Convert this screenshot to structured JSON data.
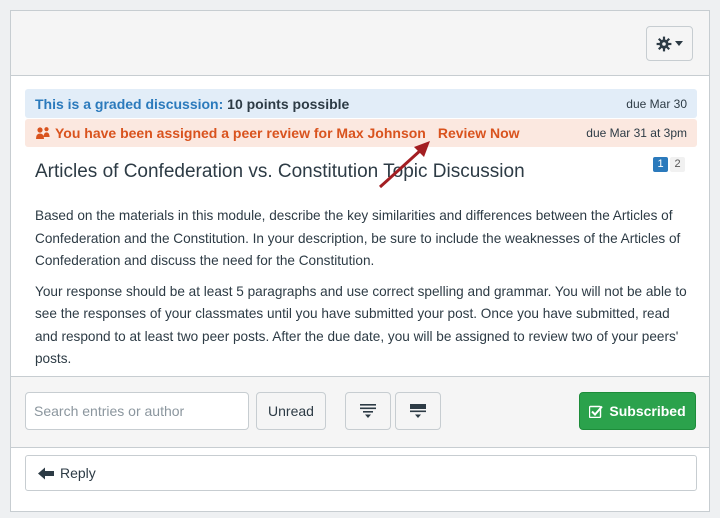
{
  "graded": {
    "label": "This is a graded discussion:",
    "points": "10 points possible",
    "due": "due Mar 30"
  },
  "peer_review": {
    "message": "You have been assigned a peer review for Max Johnson",
    "link": "Review Now",
    "due": "due Mar 31 at 3pm"
  },
  "topic": {
    "title": "Articles of Confederation vs. Constitution Topic Discussion",
    "paragraphs": [
      "Based on the materials in this module, describe the key similarities and differences between the Articles of Confederation and the Constitution. In your description, be sure to include the weaknesses of the Articles of Confederation and discuss the need for the Constitution.",
      "Your response should be at least 5 paragraphs and use correct spelling and grammar. You will not be able to see the responses of your classmates until you have submitted your post. Once you have submitted, read and respond to at least two peer posts. After the due date, you will be assigned to review two of your peers' posts."
    ]
  },
  "pager": {
    "pages": [
      "1",
      "2"
    ],
    "current": "1"
  },
  "toolbar": {
    "search_placeholder": "Search entries or author",
    "unread_label": "Unread",
    "subscribed_label": "Subscribed"
  },
  "reply": {
    "label": "Reply"
  },
  "icons": {
    "settings": "gear-icon",
    "peer_review": "peer-review-icon",
    "expand": "expand-all-icon",
    "collapse": "collapse-all-icon",
    "subscribed": "checkmark-icon",
    "reply": "reply-arrow-icon"
  },
  "colors": {
    "graded_banner_bg": "#e2edf8",
    "graded_label": "#2b7abc",
    "peer_banner_bg": "#fbe8e0",
    "peer_text": "#d9531e",
    "subscribed_bg": "#2ba24c",
    "annotation_arrow": "#a31e22"
  }
}
